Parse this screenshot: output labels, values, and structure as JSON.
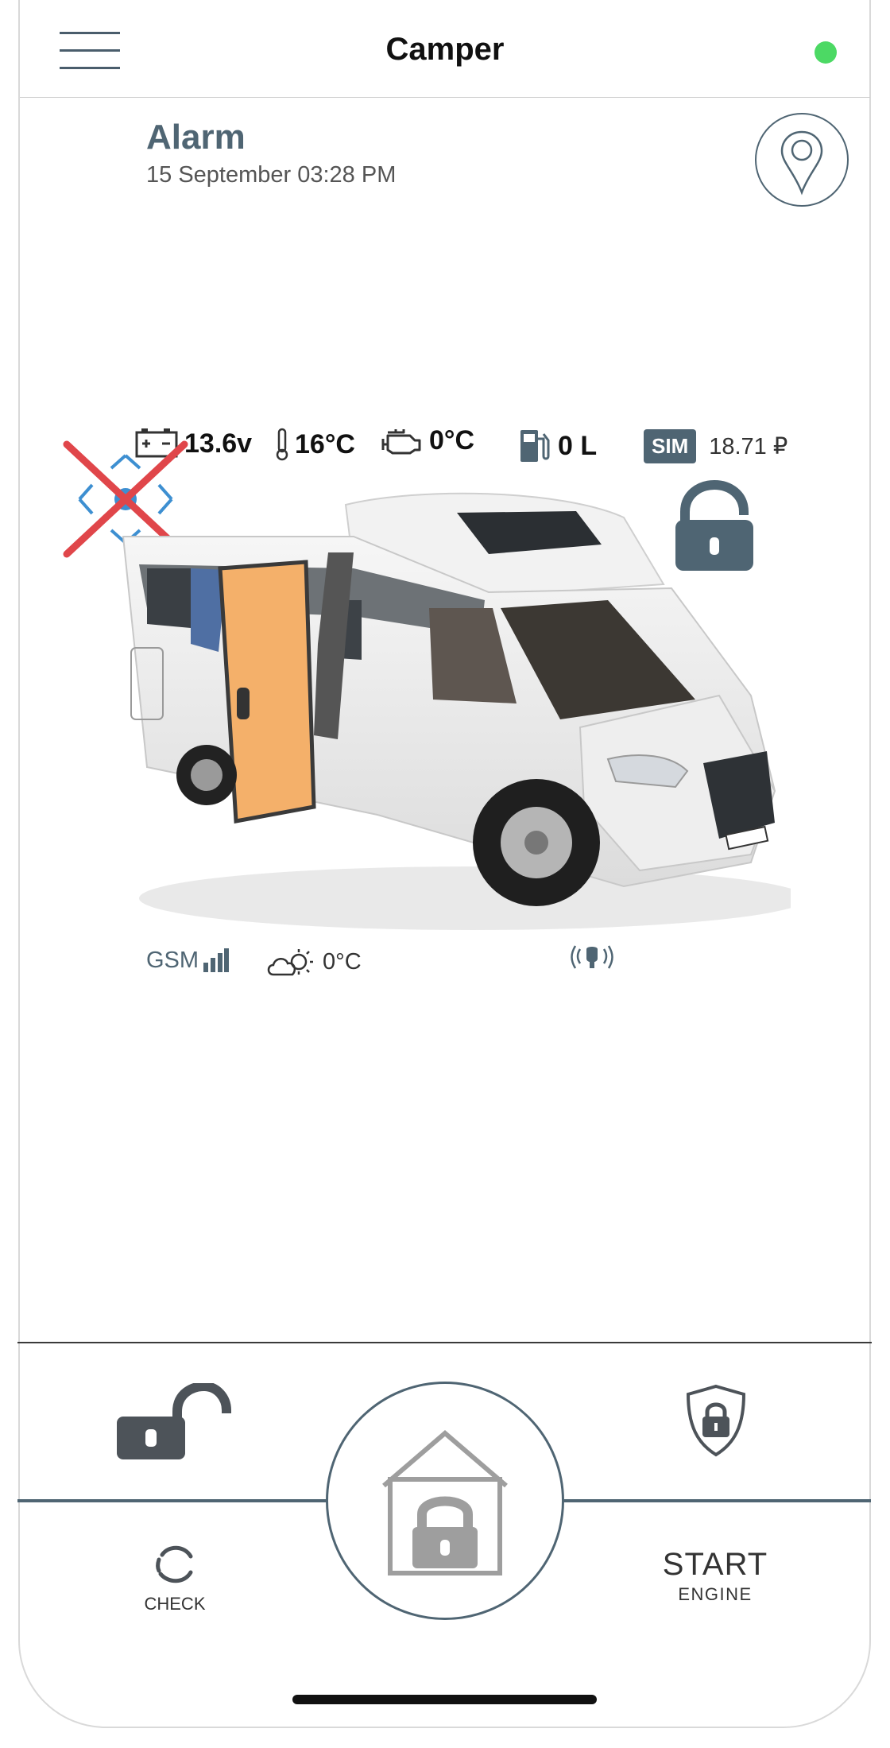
{
  "header": {
    "title": "Camper",
    "status_color": "#4cd964"
  },
  "alarm": {
    "title": "Alarm",
    "date": "15 September 03:28 PM"
  },
  "stats": {
    "battery": "13.6v",
    "cabin_temp": "16°C",
    "engine_temp": "0°C",
    "fuel": "0 L",
    "sim_label": "SIM",
    "sim_balance": "18.71 ₽"
  },
  "bottom_stats": {
    "gsm_label": "GSM",
    "outside_temp": "0°C"
  },
  "controls": {
    "check_label": "CHECK",
    "start_label": "START",
    "engine_label": "ENGINE"
  },
  "icons": {
    "menu": "hamburger-icon",
    "map": "map-pin-icon",
    "gps": "gps-lost-icon",
    "lock_state": "padlock-open-icon",
    "unlock": "unlock-icon",
    "arm": "shield-lock-icon",
    "main": "home-lock-icon",
    "check": "refresh-icon"
  },
  "colors": {
    "accent": "#4f6573",
    "alert": "#e0464a",
    "gps_blue": "#3d8fd1",
    "door": "#f4b06a"
  }
}
